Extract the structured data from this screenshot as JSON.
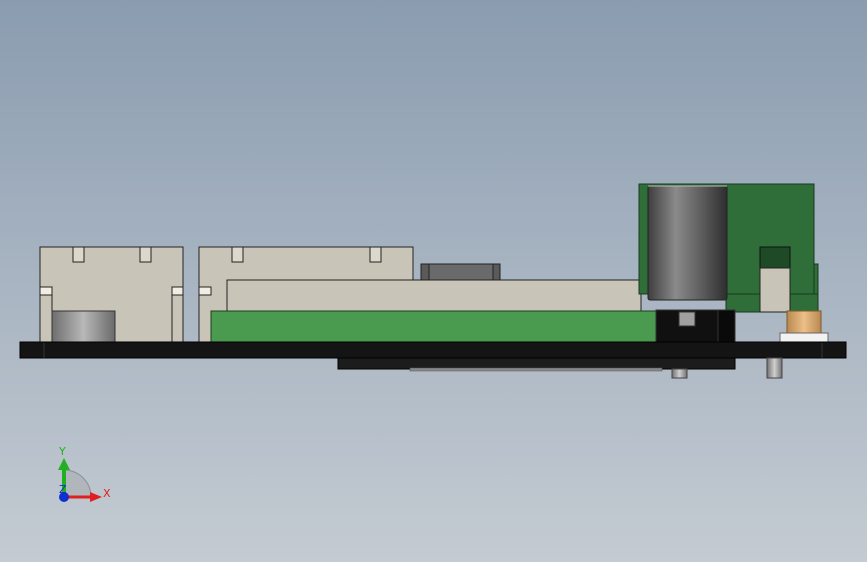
{
  "triad": {
    "x_label": "X",
    "y_label": "Y",
    "z_label": "Z",
    "x_color": "#e02020",
    "y_color": "#22b022",
    "z_color": "#1030d0"
  },
  "colors": {
    "background_top": "#8a9cb0",
    "background_bottom": "#c4cbd2",
    "pcb_black": "#141414",
    "pcb_green": "#4a9a50",
    "pcb_dark_green": "#2f6e38",
    "connector_beige": "#c9c4b8",
    "capacitor_gray": "#6b6b6b",
    "brass": "#d6a86a"
  }
}
